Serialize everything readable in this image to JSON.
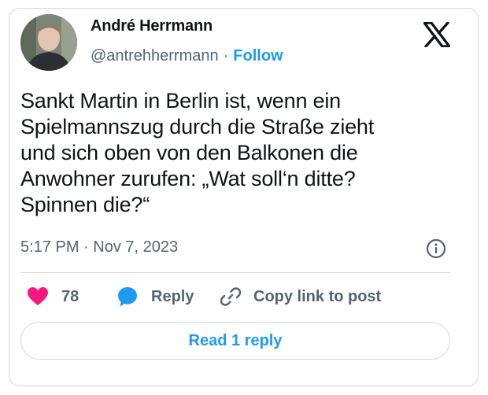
{
  "author": {
    "name": "André Herrmann",
    "handle": "@antrehherrmann",
    "separator": "·",
    "follow_label": "Follow",
    "avatar_icon": "profile-photo"
  },
  "logo": {
    "icon": "x-logo"
  },
  "tweet": {
    "lines": [
      "Sankt Martin in Berlin ist, wenn ein",
      "Spielmannszug durch die Straße zieht",
      "und sich oben von den Balkonen die",
      "Anwohner zurufen: „Wat soll‘n ditte?",
      "Spinnen die?“"
    ],
    "timestamp": "5:17 PM · Nov 7, 2023",
    "info_icon": "info-icon"
  },
  "actions": {
    "like_count": "78",
    "reply_label": "Reply",
    "copy_label": "Copy link to post"
  },
  "read_replies_label": "Read 1 reply",
  "colors": {
    "accent": "#1d9bf0",
    "like": "#f91880",
    "muted": "#536471",
    "border": "#cfd9de"
  }
}
